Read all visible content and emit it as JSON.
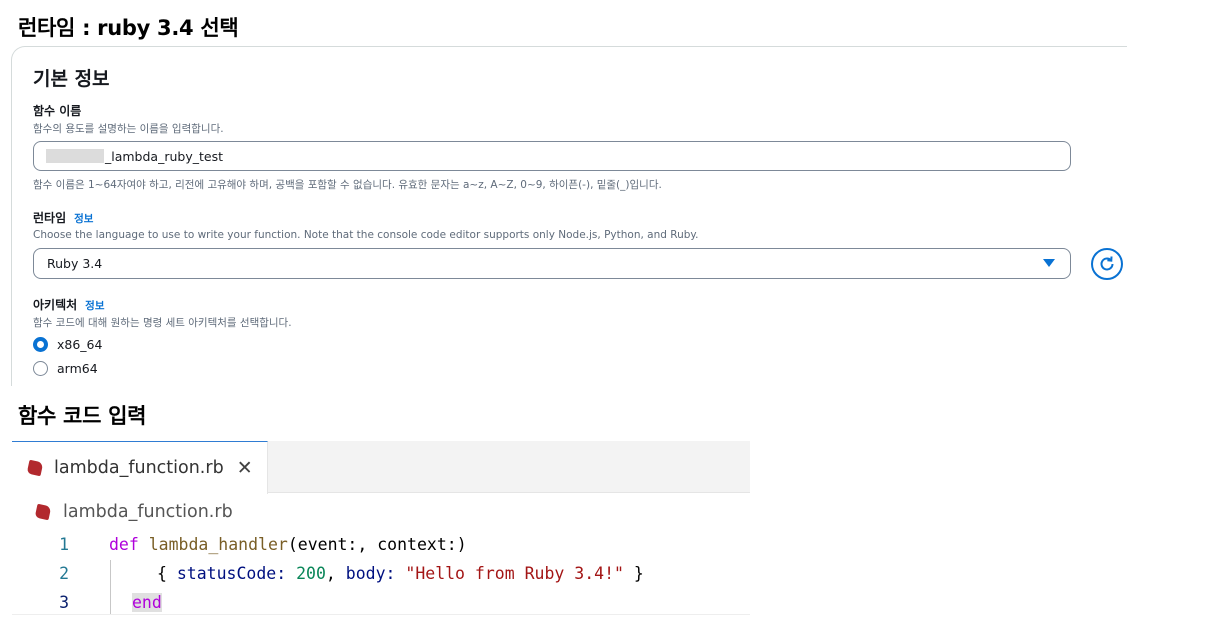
{
  "headings": {
    "runtime_select": "런타임 : ruby 3.4 선택",
    "code_input": "함수 코드 입력"
  },
  "panel": {
    "title": "기본 정보",
    "function_name": {
      "label": "함수 이름",
      "description": "함수의 용도를 설명하는 이름을 입력합니다.",
      "value": "_lambda_ruby_test",
      "constraint": "함수 이름은 1~64자여야 하고, 리전에 고유해야 하며, 공백을 포함할 수 없습니다. 유효한 문자는 a~z, A~Z, 0~9, 하이픈(-), 밑줄(_)입니다."
    },
    "runtime": {
      "label": "런타임",
      "info": "정보",
      "description": "Choose the language to use to write your function. Note that the console code editor supports only Node.js, Python, and Ruby.",
      "selected": "Ruby 3.4"
    },
    "architecture": {
      "label": "아키텍처",
      "info": "정보",
      "description": "함수 코드에 대해 원하는 명령 세트 아키텍처를 선택합니다.",
      "options": [
        {
          "label": "x86_64",
          "selected": true
        },
        {
          "label": "arm64",
          "selected": false
        }
      ]
    }
  },
  "editor": {
    "tab_label": "lambda_function.rb",
    "breadcrumb": "lambda_function.rb",
    "lines": [
      {
        "number": "1"
      },
      {
        "number": "2"
      },
      {
        "number": "3"
      }
    ],
    "tokens": {
      "def": "def",
      "handler": "lambda_handler",
      "params": "(event:, context:)",
      "open": "{ ",
      "status_key": "statusCode:",
      "status_val": "200",
      "body_key": "body:",
      "body_val": "\"Hello from Ruby 3.4!\"",
      "close": " }",
      "end": "end"
    }
  },
  "colors": {
    "accent": "#0972d3",
    "ruby_icon": "#b2292e",
    "keyword": "#af00db",
    "string": "#a31515",
    "number": "#098658"
  }
}
